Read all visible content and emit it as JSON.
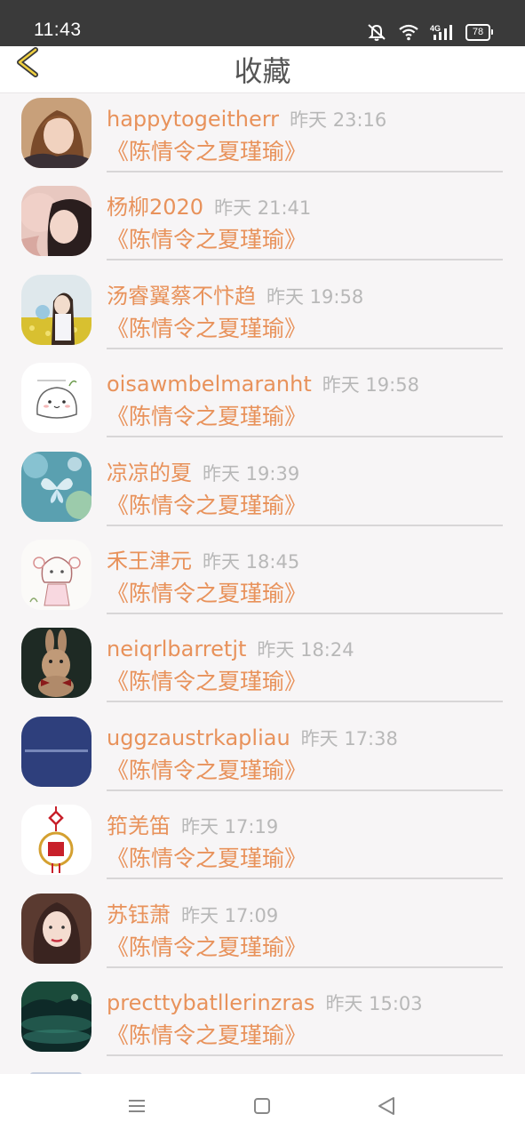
{
  "status_bar": {
    "time": "11:43",
    "network": "4G",
    "battery": "78"
  },
  "header": {
    "title": "收藏"
  },
  "colors": {
    "accent": "#e8925b",
    "timestamp": "#b8b8b8",
    "header_bg": "#ffffff",
    "status_bg": "#3a3a3a"
  },
  "favorites": [
    {
      "user": "happytogeitherr",
      "time": "昨天 23:16",
      "book": "《陈情令之夏瑾瑜》",
      "avatar": "woman-selfie-avatar"
    },
    {
      "user": "杨柳2020",
      "time": "昨天 21:41",
      "book": "《陈情令之夏瑾瑜》",
      "avatar": "woman-portrait-avatar"
    },
    {
      "user": "汤睿翼蔡不忭趋",
      "time": "昨天 19:58",
      "book": "《陈情令之夏瑾瑜》",
      "avatar": "girl-flower-field-avatar"
    },
    {
      "user": "oisawmbelmaranht",
      "time": "昨天 19:58",
      "book": "《陈情令之夏瑾瑜》",
      "avatar": "cartoon-bun-avatar"
    },
    {
      "user": "凉凉的夏",
      "time": "昨天 19:39",
      "book": "《陈情令之夏瑾瑜》",
      "avatar": "butterfly-avatar"
    },
    {
      "user": "禾王津元",
      "time": "昨天 18:45",
      "book": "《陈情令之夏瑾瑜》",
      "avatar": "anime-girl-sketch-avatar"
    },
    {
      "user": "neiqrlbarretjt",
      "time": "昨天 18:24",
      "book": "《陈情令之夏瑾瑜》",
      "avatar": "rabbit-avatar"
    },
    {
      "user": "uggzaustrkapliau",
      "time": "昨天 17:38",
      "book": "《陈情令之夏瑾瑜》",
      "avatar": "blue-text-avatar"
    },
    {
      "user": "筘羌笛",
      "time": "昨天 17:19",
      "book": "《陈情令之夏瑾瑜》",
      "avatar": "fu-knot-avatar"
    },
    {
      "user": "苏钰萧",
      "time": "昨天 17:09",
      "book": "《陈情令之夏瑾瑜》",
      "avatar": "woman-glam-avatar"
    },
    {
      "user": "precttybatllerinzras",
      "time": "昨天 15:03",
      "book": "《陈情令之夏瑾瑜》",
      "avatar": "night-landscape-avatar"
    }
  ]
}
